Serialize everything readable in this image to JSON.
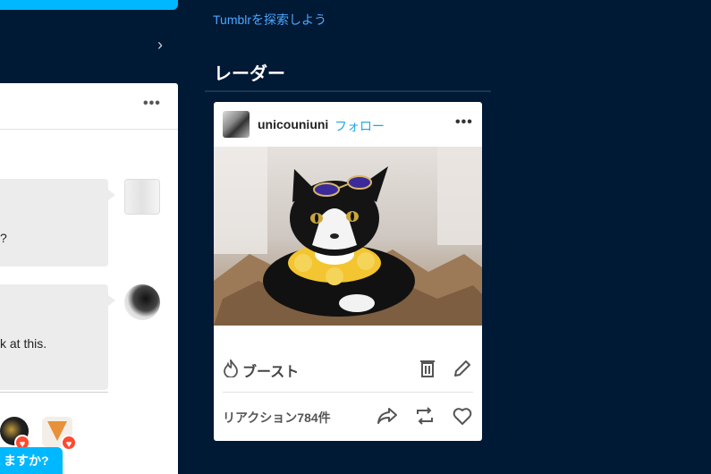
{
  "left": {
    "bubble1_text": "?",
    "bubble2_text": "k at this.",
    "cta_label": "ますか?"
  },
  "right": {
    "explore_link": "Tumblrを探索しよう",
    "section_title": "レーダー",
    "post": {
      "username": "unicouniuni",
      "follow_label": "フォロー",
      "boost_label": "ブースト",
      "reactions_label": "リアクション784件"
    }
  },
  "icons": [
    "chevron-right-icon",
    "more-dots-icon",
    "heart-icon",
    "flame-icon",
    "delete-icon",
    "edit-icon",
    "share-icon",
    "reblog-icon",
    "like-icon"
  ],
  "colors": {
    "background": "#001935",
    "accent": "#00b8ff",
    "link": "#4aa8ff",
    "follow": "#1fa8e4",
    "badge": "#ff4930"
  }
}
